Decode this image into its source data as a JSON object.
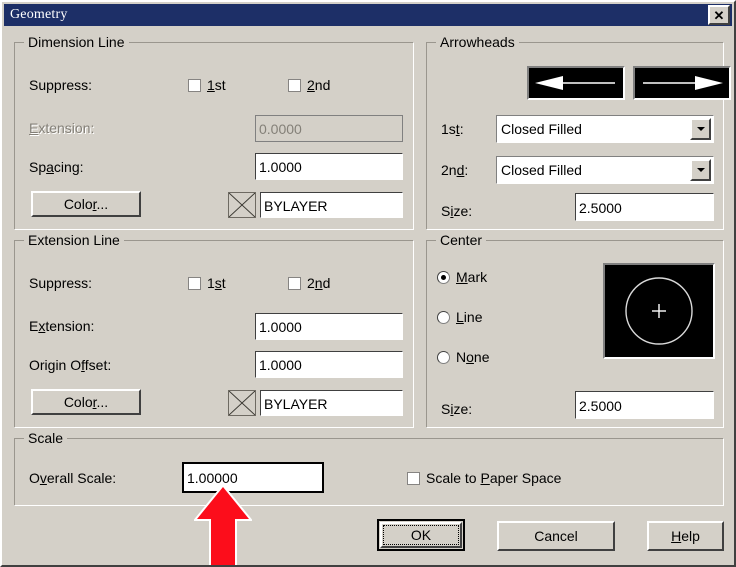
{
  "window": {
    "title": "Geometry",
    "close_label": "✕",
    "titlebar_color": "#1d2f67",
    "face_color": "#d4d0c8"
  },
  "dimension_line": {
    "title": "Dimension Line",
    "suppress_label": "Suppress:",
    "suppress_1st": {
      "label_mnemonic": "1",
      "label_rest": "st",
      "checked": false
    },
    "suppress_2nd": {
      "label_mnemonic": "2",
      "label_rest": "nd",
      "checked": false
    },
    "extension_label_mnemonic": "E",
    "extension_label_rest": "xtension:",
    "extension_value": "0.0000",
    "extension_disabled": true,
    "spacing_label_a": "Sp",
    "spacing_label_mnemonic": "a",
    "spacing_label_b": "cing:",
    "spacing_value": "1.0000",
    "color_button_a": "Colo",
    "color_button_mnemonic": "r",
    "color_button_b": "...",
    "color_value": "BYLAYER"
  },
  "extension_line": {
    "title": "Extension Line",
    "suppress_label": "Suppress:",
    "suppress_1st": {
      "label_a": "1",
      "label_mnemonic": "s",
      "label_b": "t",
      "checked": false
    },
    "suppress_2nd": {
      "label_a": "2",
      "label_mnemonic": "n",
      "label_b": "d",
      "checked": false
    },
    "extension_label_a": "E",
    "extension_label_mnemonic": "x",
    "extension_label_b": "tension:",
    "extension_value": "1.0000",
    "origin_offset_label_a": "Origin O",
    "origin_offset_mnemonic": "f",
    "origin_offset_label_b": "fset:",
    "origin_offset_value": "1.0000",
    "color_button_a": "Colo",
    "color_button_mnemonic": "r",
    "color_button_b": "...",
    "color_value": "BYLAYER"
  },
  "arrowheads": {
    "title": "Arrowheads",
    "first_label_a": "1s",
    "first_label_mnemonic": "t",
    "first_label_b": ":",
    "first_value": "Closed Filled",
    "second_label_a": "2n",
    "second_label_mnemonic": "d",
    "second_label_b": ":",
    "second_value": "Closed Filled",
    "size_label_a": "S",
    "size_label_mnemonic": "i",
    "size_label_b": "ze:",
    "size_value": "2.5000",
    "preview_left_name": "arrow-left-preview",
    "preview_right_name": "arrow-right-preview"
  },
  "center": {
    "title": "Center",
    "options": [
      {
        "label_mnemonic": "M",
        "label_rest": "ark",
        "selected": true
      },
      {
        "label_mnemonic": "L",
        "label_rest": "ine",
        "selected": false
      },
      {
        "label_a": "N",
        "label_mnemonic": "o",
        "label_b": "ne",
        "selected": false
      }
    ],
    "size_label_a": "S",
    "size_label_mnemonic": "i",
    "size_label_b": "ze:",
    "size_value": "2.5000"
  },
  "scale": {
    "title": "Scale",
    "overall_label_a": "O",
    "overall_label_mnemonic": "v",
    "overall_label_b": "erall Scale:",
    "overall_value": "1.00000",
    "paper_space_a": "Scale to ",
    "paper_space_mnemonic": "P",
    "paper_space_b": "aper Space",
    "paper_space_checked": false
  },
  "buttons": {
    "ok": "OK",
    "cancel": "Cancel",
    "help_mnemonic": "H",
    "help_rest": "elp"
  },
  "annotation": {
    "arrow_color": "#fc0d1b",
    "arrow_outline": "#ffffff"
  }
}
